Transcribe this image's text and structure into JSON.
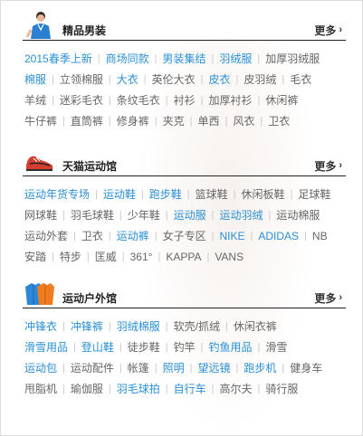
{
  "colors": {
    "link_blue": "#2a8fd4",
    "link_gray": "#666666",
    "rule": "#222222"
  },
  "sections": [
    {
      "id": "mens",
      "title": "精品男装",
      "more": "更多",
      "icon": "model-icon",
      "rows": [
        [
          {
            "t": "2015春季上新",
            "h": true
          },
          {
            "t": "商场同款",
            "h": true
          },
          {
            "t": "男装集结",
            "h": true
          },
          {
            "t": "羽绒服",
            "h": true
          },
          {
            "t": "加厚羽绒服",
            "h": false
          }
        ],
        [
          {
            "t": "棉服",
            "h": true
          },
          {
            "t": "立领棉服",
            "h": false
          },
          {
            "t": "大衣",
            "h": true
          },
          {
            "t": "英伦大衣",
            "h": false
          },
          {
            "t": "皮衣",
            "h": true
          },
          {
            "t": "皮羽绒",
            "h": false
          },
          {
            "t": "毛衣",
            "h": false
          }
        ],
        [
          {
            "t": "羊绒",
            "h": false
          },
          {
            "t": "迷彩毛衣",
            "h": false
          },
          {
            "t": "条纹毛衣",
            "h": false
          },
          {
            "t": "衬衫",
            "h": false
          },
          {
            "t": "加厚衬衫",
            "h": false
          },
          {
            "t": "休闲裤",
            "h": false
          }
        ],
        [
          {
            "t": "牛仔裤",
            "h": false
          },
          {
            "t": "直筒裤",
            "h": false
          },
          {
            "t": "修身裤",
            "h": false
          },
          {
            "t": "夹克",
            "h": false
          },
          {
            "t": "单西",
            "h": false
          },
          {
            "t": "风衣",
            "h": false
          },
          {
            "t": "卫衣",
            "h": false
          }
        ]
      ]
    },
    {
      "id": "sports",
      "title": "天猫运动馆",
      "more": "更多",
      "icon": "sneaker-icon",
      "rows": [
        [
          {
            "t": "运动年货专场",
            "h": true
          },
          {
            "t": "运动鞋",
            "h": true
          },
          {
            "t": "跑步鞋",
            "h": true
          },
          {
            "t": "篮球鞋",
            "h": false
          },
          {
            "t": "休闲板鞋",
            "h": false
          },
          {
            "t": "足球鞋",
            "h": false
          }
        ],
        [
          {
            "t": "网球鞋",
            "h": false
          },
          {
            "t": "羽毛球鞋",
            "h": false
          },
          {
            "t": "少年鞋",
            "h": false
          },
          {
            "t": "运动服",
            "h": true
          },
          {
            "t": "运动羽绒",
            "h": true
          },
          {
            "t": "运动棉服",
            "h": false
          }
        ],
        [
          {
            "t": "运动外套",
            "h": false
          },
          {
            "t": "卫衣",
            "h": false
          },
          {
            "t": "运动裤",
            "h": true
          },
          {
            "t": "女子专区",
            "h": false
          },
          {
            "t": "NIKE",
            "h": true
          },
          {
            "t": "ADIDAS",
            "h": true
          },
          {
            "t": "NB",
            "h": false
          }
        ],
        [
          {
            "t": "安踏",
            "h": false
          },
          {
            "t": "特步",
            "h": false
          },
          {
            "t": "匡威",
            "h": false
          },
          {
            "t": "361°",
            "h": false
          },
          {
            "t": "KAPPA",
            "h": false
          },
          {
            "t": "VANS",
            "h": false
          }
        ]
      ]
    },
    {
      "id": "outdoor",
      "title": "运动户外馆",
      "more": "更多",
      "icon": "jackets-icon",
      "rows": [
        [
          {
            "t": "冲锋衣",
            "h": true
          },
          {
            "t": "冲锋裤",
            "h": true
          },
          {
            "t": "羽绒棉服",
            "h": true
          },
          {
            "t": "软壳/抓绒",
            "h": false
          },
          {
            "t": "休闲衣裤",
            "h": false
          }
        ],
        [
          {
            "t": "滑雪用品",
            "h": true
          },
          {
            "t": "登山鞋",
            "h": true
          },
          {
            "t": "徒步鞋",
            "h": false
          },
          {
            "t": "钓竿",
            "h": false
          },
          {
            "t": "钓鱼用品",
            "h": true
          },
          {
            "t": "滑雪",
            "h": false
          }
        ],
        [
          {
            "t": "运动包",
            "h": true
          },
          {
            "t": "运动配件",
            "h": false
          },
          {
            "t": "帐篷",
            "h": false
          },
          {
            "t": "照明",
            "h": true
          },
          {
            "t": "望远镜",
            "h": true
          },
          {
            "t": "跑步机",
            "h": true
          },
          {
            "t": "健身车",
            "h": false
          }
        ],
        [
          {
            "t": "甩脂机",
            "h": false
          },
          {
            "t": "瑜伽服",
            "h": false
          },
          {
            "t": "羽毛球拍",
            "h": true
          },
          {
            "t": "自行车",
            "h": true
          },
          {
            "t": "高尔夫",
            "h": false
          },
          {
            "t": "骑行服",
            "h": false
          }
        ]
      ]
    }
  ]
}
